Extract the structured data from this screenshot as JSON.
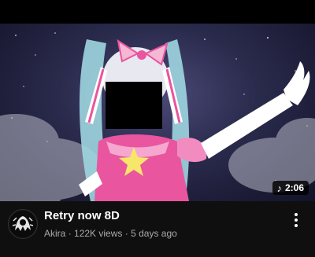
{
  "video": {
    "title": "Retry now 8D",
    "channel": "Akira",
    "views": "122K views",
    "age": "5 days ago",
    "separator": "·",
    "duration": "2:06"
  },
  "icons": {
    "duration_icon": "music-note-icon",
    "menu_icon": "more-vertical-icon",
    "avatar_icon": "channel-avatar-icon"
  },
  "colors": {
    "background": "#0f0f0f",
    "secondary_text": "#aaaaaa",
    "pink_accent": "#e9559e",
    "hair": "#9fd6e0",
    "badge_bg": "#000000"
  }
}
